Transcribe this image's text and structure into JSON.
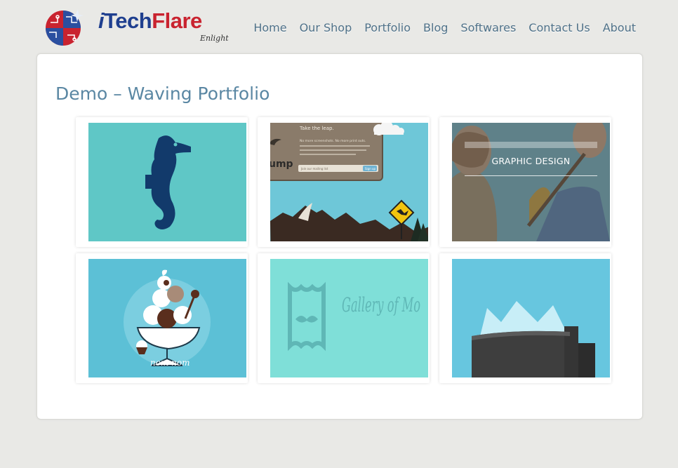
{
  "brand": {
    "i": "i",
    "tech": "Tech",
    "flare": "Flare",
    "tagline": "Enlight"
  },
  "nav": [
    "Home",
    "Our Shop",
    "Portfolio",
    "Blog",
    "Softwares",
    "Contact Us",
    "About"
  ],
  "page": {
    "title": "Demo – Waving Portfolio"
  },
  "items": [
    {
      "image": "seahorse-illustration"
    },
    {
      "image": "take-the-leap-web-design",
      "text": {
        "heading": "Take the leap.",
        "sub": "No more screenshots. No more print outs.",
        "field": "Join our mailing list",
        "button": "Sign up",
        "logo": "ump"
      }
    },
    {
      "image": "lumberjack-illustration",
      "overlay": "GRAPHIC DESIGN"
    },
    {
      "image": "nom-nom-ice-cream",
      "text": "nom nom"
    },
    {
      "image": "gallery-of-mo",
      "text": "Gallery of Mo"
    },
    {
      "image": "glass-building-illustration"
    }
  ],
  "colors": {
    "title": "#5a87a3",
    "nav": "#4f7188",
    "brand_blue": "#1f3f8f",
    "brand_red": "#c9232f"
  }
}
